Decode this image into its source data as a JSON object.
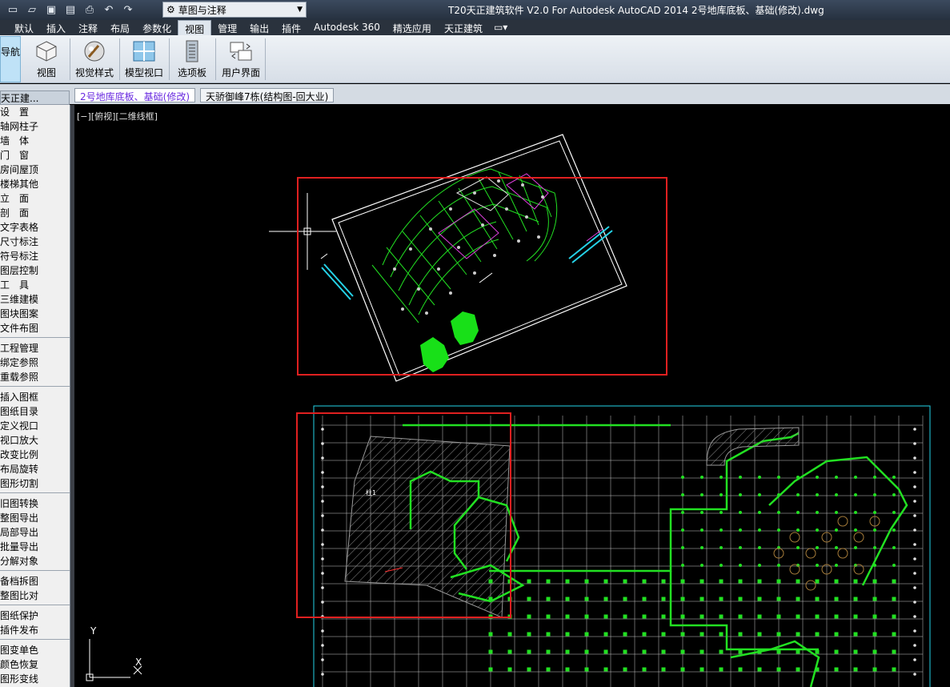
{
  "window": {
    "title": "T20天正建筑软件 V2.0 For Autodesk AutoCAD 2014    2号地库底板、基础(修改).dwg",
    "workspace": "草图与注释"
  },
  "menu_tabs": [
    {
      "label": "默认"
    },
    {
      "label": "插入"
    },
    {
      "label": "注释"
    },
    {
      "label": "布局"
    },
    {
      "label": "参数化"
    },
    {
      "label": "视图",
      "active": true
    },
    {
      "label": "管理"
    },
    {
      "label": "输出"
    },
    {
      "label": "插件"
    },
    {
      "label": "Autodesk 360"
    },
    {
      "label": "精选应用"
    },
    {
      "label": "天正建筑"
    }
  ],
  "ribbon": {
    "nav_label": "导航",
    "buttons": [
      {
        "label": "视图"
      },
      {
        "label": "视觉样式"
      },
      {
        "label": "模型视口"
      },
      {
        "label": "选项板"
      },
      {
        "label": "用户界面"
      }
    ]
  },
  "file_tabs": [
    {
      "label": "2号地库底板、基础(修改)",
      "active": true
    },
    {
      "label": "天骄御峰7栋(结构图-回大业)"
    }
  ],
  "left_panel": {
    "header": "天正建...",
    "groups": [
      [
        "设　置",
        "轴网柱子",
        "墙　体",
        "门　窗",
        "房间屋顶",
        "楼梯其他",
        "立　面",
        "剖　面",
        "文字表格",
        "尺寸标注",
        "符号标注",
        "图层控制",
        "工　具",
        "三维建模",
        "图块图案",
        "文件布图"
      ],
      [
        "工程管理",
        "绑定参照",
        "重载参照"
      ],
      [
        "插入图框",
        "图纸目录",
        "定义视口",
        "视口放大",
        "改变比例",
        "布局旋转",
        "图形切割"
      ],
      [
        "旧图转换",
        "整图导出",
        "局部导出",
        "批量导出",
        "分解对象"
      ],
      [
        "备档拆图",
        "整图比对"
      ],
      [
        "图纸保护",
        "插件发布"
      ],
      [
        "图变单色",
        "颜色恢复",
        "图形变线"
      ]
    ]
  },
  "canvas": {
    "view_label": "[−][俯视][二维线框]",
    "ucs_x": "X",
    "ucs_y": "Y",
    "label_marker": "柱1"
  },
  "colors": {
    "highlight_box": "#e02020",
    "grid_green": "#22e022",
    "cyan": "#25d3e8",
    "magenta": "#e040e0",
    "hatch_gray": "#9a9a9a",
    "white": "#ffffff"
  }
}
